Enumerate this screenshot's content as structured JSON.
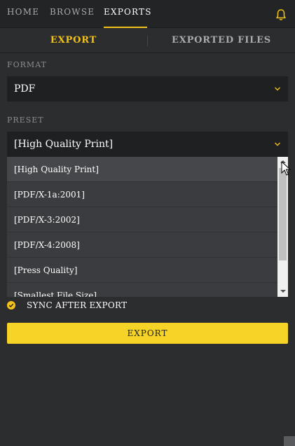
{
  "nav": {
    "home": "HOME",
    "browse": "BROWSE",
    "exports": "EXPORTS",
    "bell_icon": "bell-icon"
  },
  "tabs": {
    "export": "EXPORT",
    "exported_files": "EXPORTED FILES"
  },
  "format": {
    "label": "FORMAT",
    "value": "PDF"
  },
  "preset": {
    "label": "PRESET",
    "value": "[High Quality Print]",
    "options": [
      "[High Quality Print]",
      "[PDF/X-1a:2001]",
      "[PDF/X-3:2002]",
      "[PDF/X-4:2008]",
      "[Press Quality]",
      "[Smallest File Size]"
    ]
  },
  "sync": {
    "label": "SYNC AFTER EXPORT",
    "checked": true
  },
  "export_button": {
    "label": "EXPORT"
  },
  "colors": {
    "accent": "#f2c21b",
    "button": "#f5d327",
    "background": "#2c2d2f",
    "select_bg": "#1f2022"
  }
}
